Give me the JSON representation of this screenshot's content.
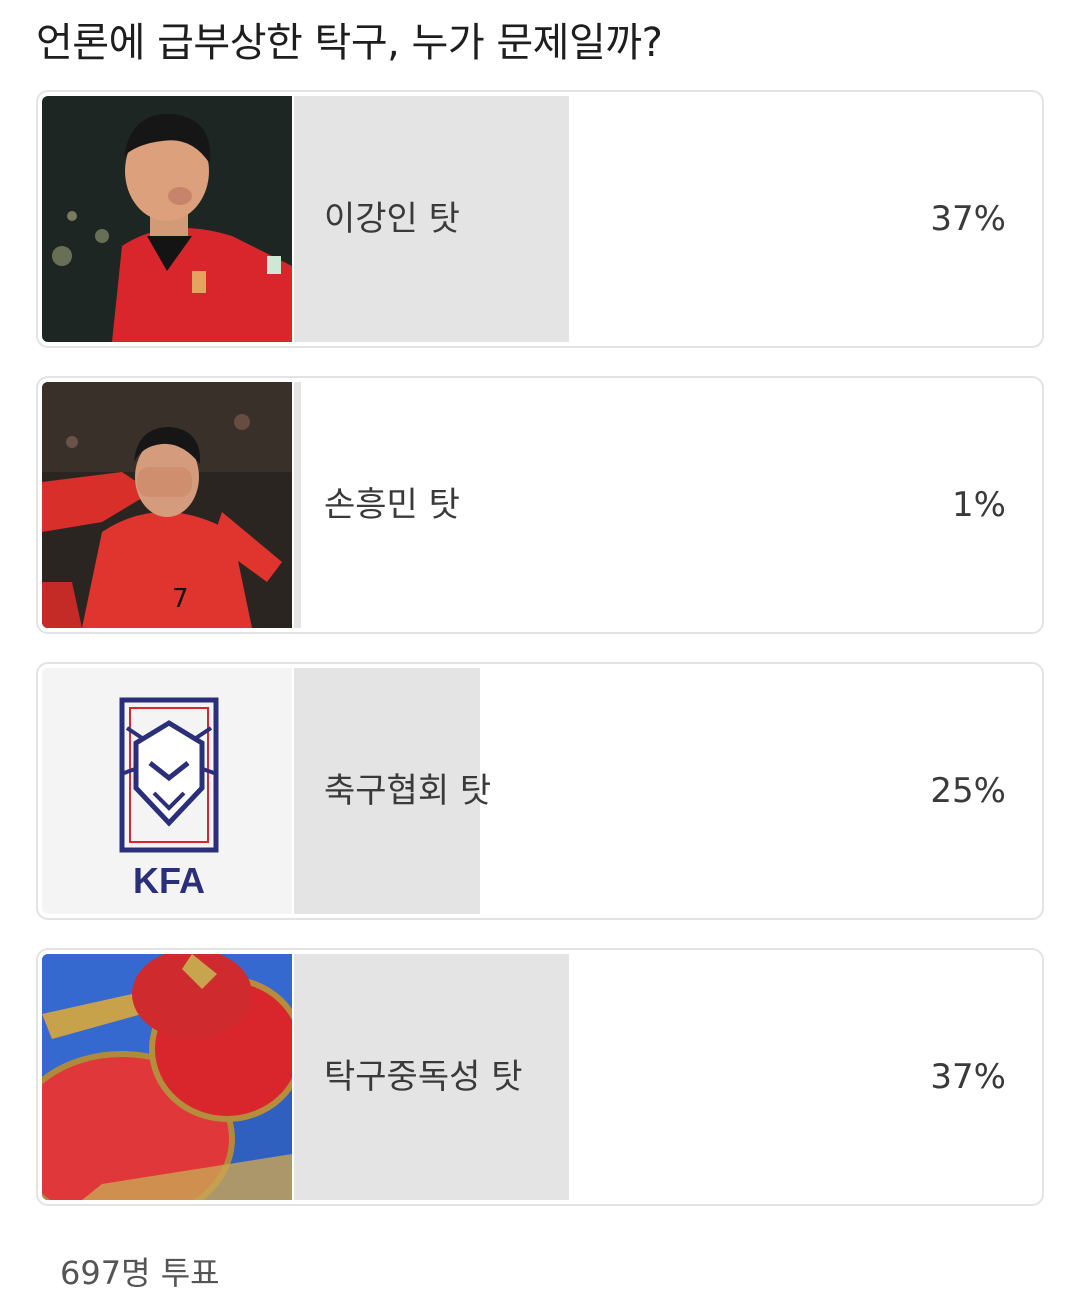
{
  "poll": {
    "question": "언론에 급부상한 탁구, 누가 문제일까?",
    "options": [
      {
        "label": "이강인 탓",
        "percent": "37%",
        "fraction": 0.37,
        "image": "player-lee-kangin-photo"
      },
      {
        "label": "손흥민 탓",
        "percent": "1%",
        "fraction": 0.01,
        "image": "player-son-heungmin-photo"
      },
      {
        "label": "축구협회 탓",
        "percent": "25%",
        "fraction": 0.25,
        "image": "kfa-logo",
        "logo_text": "KFA"
      },
      {
        "label": "탁구중독성 탓",
        "percent": "37%",
        "fraction": 0.37,
        "image": "table-tennis-paddles-photo"
      }
    ],
    "vote_count": "697명 투표"
  }
}
